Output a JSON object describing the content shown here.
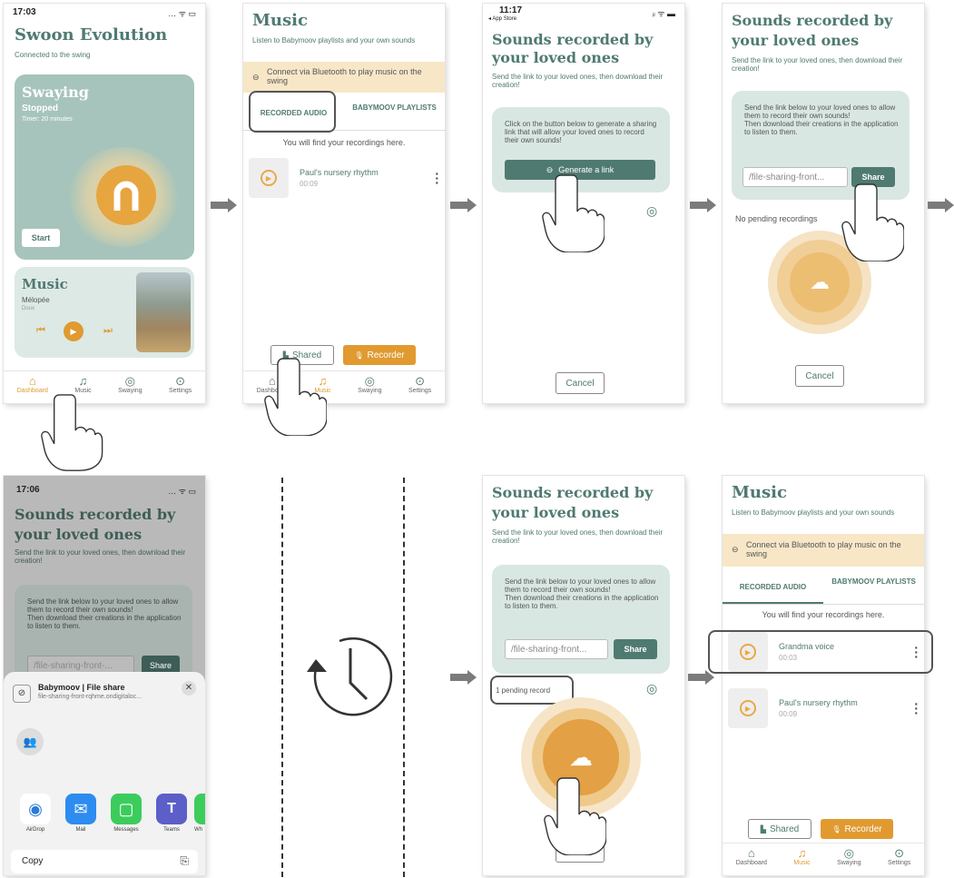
{
  "s1": {
    "time": "17:03",
    "title": "Swoon Evolution",
    "sub": "Connected to the swing",
    "sway_title": "Swaying",
    "sway_status": "Stopped",
    "timer": "Timer: 20 minutes",
    "start": "Start",
    "music_title": "Music",
    "track": "Mélopée",
    "track_sub": "Doux"
  },
  "tabs": {
    "dashboard": "Dashboard",
    "music": "Music",
    "swaying": "Swaying",
    "settings": "Settings"
  },
  "music": {
    "title": "Music",
    "sub": "Listen to Babymoov playlists and your own sounds",
    "bt": "Connect via Bluetooth to play music on the swing",
    "tab1": "RECORDED AUDIO",
    "tab2": "BABYMOOV PLAYLISTS",
    "find": "You will find your recordings here.",
    "rec1": "Paul's nursery rhythm",
    "rec1_time": "00:09",
    "shared": "Shared",
    "recorder": "Recorder"
  },
  "s3": {
    "time": "11:17",
    "store": "◂ App Store",
    "title": "Sounds recorded by your loved ones",
    "sub": "Send the link to your loved ones, then download their creation!",
    "panel": "Click on the button below to generate a sharing link that will allow your loved ones to record their own sounds!",
    "gen": "Generate a link",
    "cancel": "Cancel"
  },
  "s4": {
    "title": "Sounds recorded by your loved ones",
    "sub": "Send the link to your loved ones, then download their creation!",
    "panel": "Send the link below to your loved ones to allow them to record their own sounds!\nThen download their creations in the application to listen to them.",
    "input": "/file-sharing-front...",
    "share": "Share",
    "pending": "No pending recordings",
    "cancel": "Cancel"
  },
  "s5": {
    "time": "17:06",
    "title": "Sounds recorded by your loved ones",
    "sub": "Send the link to your loved ones, then download their creation!",
    "panel": "Send the link below to your loved ones to allow them to record their own sounds!\nThen download their creations in the application to listen to them.",
    "input": "/file-sharing-front-...",
    "share": "Share",
    "sheet_title": "Babymoov | File share",
    "sheet_url": "file-sharing-front-rqhme.ondigitaloc...",
    "apps": [
      "AirDrop",
      "Mail",
      "Messages",
      "Teams",
      "Wh"
    ],
    "copy": "Copy"
  },
  "s6": {
    "title": "Sounds recorded by your loved ones",
    "sub": "Send the link to your loved ones, then download their creation!",
    "panel": "Send the link below to your loved ones to allow them to record their own sounds!\nThen download their creations in the application to listen to them.",
    "input": "/file-sharing-front...",
    "share": "Share",
    "pending": "1 pending record",
    "cancel": "Cancel"
  },
  "s7": {
    "rec0": "Grandma voice",
    "rec0_time": "00:03"
  },
  "colors": {
    "teal": "#4f7a71",
    "orange": "#e09a30",
    "panel": "#d9e7e2",
    "bt": "#f7e7c7"
  }
}
